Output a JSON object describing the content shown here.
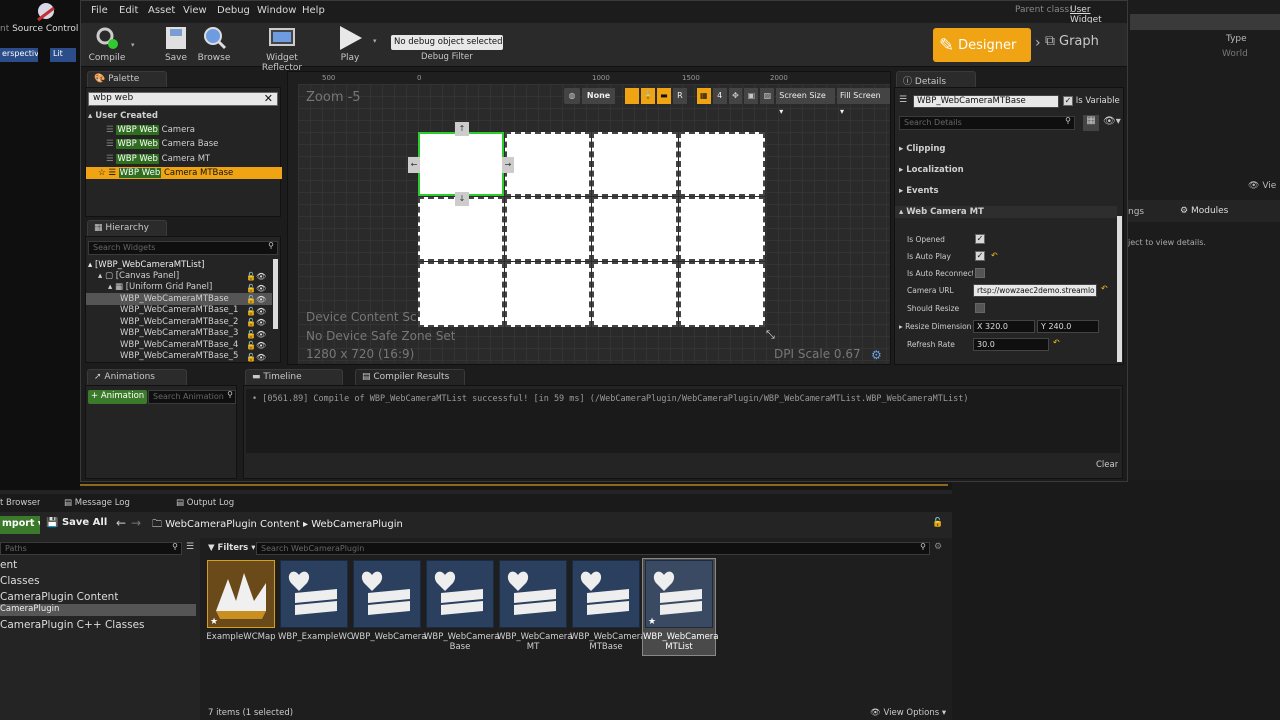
{
  "outer": {
    "source_control": "Source Control",
    "perspective": "erspective",
    "lit": "Lit",
    "right_type": "Type",
    "right_world": "World",
    "right_view": "Vie",
    "right_ngs": "ngs",
    "right_modules": "Modules",
    "right_hint": "ject to view details."
  },
  "window": {
    "menu": [
      "File",
      "Edit",
      "Asset",
      "View",
      "Debug",
      "Window",
      "Help"
    ],
    "parent_class_label": "Parent class:",
    "parent_class_value": "User Widget",
    "toolbar": {
      "compile": "Compile",
      "save": "Save",
      "browse": "Browse",
      "widget_reflector": "Widget Reflector",
      "play": "Play",
      "debug_select": "No debug object selected",
      "debug_filter": "Debug Filter",
      "designer": "Designer",
      "graph": "Graph"
    }
  },
  "palette": {
    "tab": "Palette",
    "search_value": "wbp web",
    "category": "User Created",
    "items": [
      {
        "hl": "WBP Web",
        "rest": " Camera"
      },
      {
        "hl": "WBP Web",
        "rest": " Camera Base"
      },
      {
        "hl": "WBP Web",
        "rest": " Camera MT"
      },
      {
        "hl": "WBP Web",
        "rest": " Camera MTBase"
      }
    ]
  },
  "hierarchy": {
    "tab": "Hierarchy",
    "search_placeholder": "Search Widgets",
    "items": [
      "[WBP_WebCameraMTList]",
      "[Canvas Panel]",
      "[Uniform Grid Panel]",
      "WBP_WebCameraMTBase",
      "WBP_WebCameraMTBase_1",
      "WBP_WebCameraMTBase_2",
      "WBP_WebCameraMTBase_3",
      "WBP_WebCameraMTBase_4",
      "WBP_WebCameraMTBase_5"
    ]
  },
  "designer": {
    "zoom": "Zoom -5",
    "ruler": [
      "500",
      "0",
      "1000",
      "1500",
      "2000"
    ],
    "none_btn": "None",
    "r_btn": "R",
    "four_btn": "4",
    "screen_size": "Screen Size",
    "fill_screen": "Fill Screen",
    "device_content": "Device Content Sc",
    "no_safe_zone": "No Device Safe Zone Set",
    "resolution": "1280 x 720 (16:9)",
    "dpi": "DPI Scale 0.67"
  },
  "details": {
    "tab": "Details",
    "widget_name": "WBP_WebCameraMTBase",
    "is_variable": "Is Variable",
    "search_placeholder": "Search Details",
    "sections": [
      "Clipping",
      "Localization",
      "Events",
      "Web Camera MT"
    ],
    "props": {
      "is_opened": "Is Opened",
      "is_auto_play": "Is Auto Play",
      "is_auto_reconnect": "Is Auto Reconnect",
      "camera_url_label": "Camera URL",
      "camera_url_value": "rtsp://wowzaec2demo.streamlo",
      "should_resize": "Should Resize",
      "resize_dim_label": "Resize Dimension",
      "resize_x": "320.0",
      "resize_y": "240.0",
      "x": "X",
      "y": "Y",
      "refresh_label": "Refresh Rate",
      "refresh_value": "30.0"
    }
  },
  "bottom": {
    "animations_tab": "Animations",
    "add_animation": "+ Animation",
    "search_animation": "Search Animation",
    "timeline_tab": "Timeline",
    "compiler_tab": "Compiler Results",
    "log_line": "[0561.89] Compile of WBP_WebCameraMTList successful! [in 59 ms] (/WebCameraPlugin/WebCameraPlugin/WBP_WebCameraMTList.WBP_WebCameraMTList)",
    "clear": "Clear"
  },
  "content_browser": {
    "tabs": [
      "t Browser",
      "Message Log",
      "Output Log"
    ],
    "import": "mport",
    "save_all": "Save All",
    "breadcrumb": [
      "WebCameraPlugin Content",
      "WebCameraPlugin"
    ],
    "paths_placeholder": "Paths",
    "tree": [
      "ent",
      "Classes",
      "CameraPlugin Content",
      "CameraPlugin",
      "CameraPlugin C++ Classes"
    ],
    "filters": "Filters",
    "search_placeholder": "Search WebCameraPlugin",
    "assets": [
      "ExampleWCMap",
      "WBP_ExampleWC",
      "WBP_WebCamera",
      "WBP_WebCamera Base",
      "WBP_WebCamera MT",
      "WBP_WebCamera MTBase",
      "WBP_WebCamera MTList"
    ],
    "status": "7 items (1 selected)",
    "view_options": "View Options"
  },
  "colors": {
    "accent": "#f0a413",
    "highlight_green": "#2f6e1f",
    "selection_green": "#2ecc2e"
  }
}
